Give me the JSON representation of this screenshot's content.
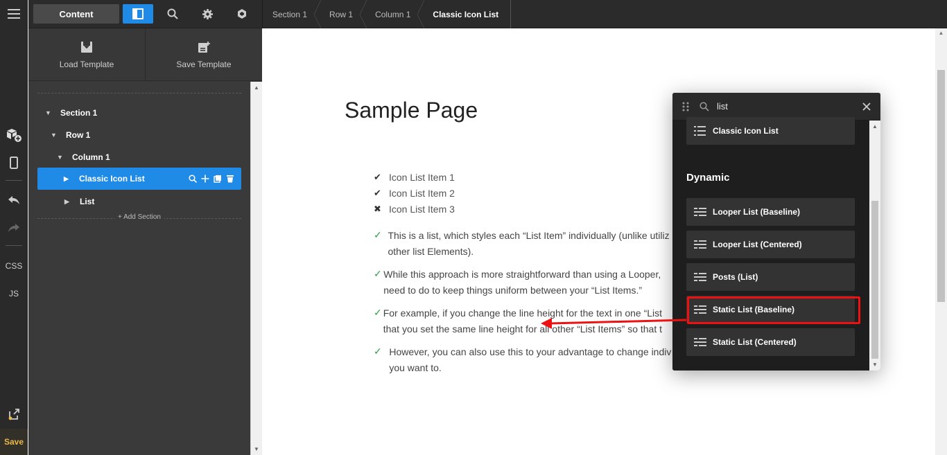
{
  "rail": {
    "css_label": "CSS",
    "js_label": "JS",
    "save_label": "Save"
  },
  "topbar": {
    "content_label": "Content",
    "breadcrumbs": [
      "Section 1",
      "Row 1",
      "Column 1",
      "Classic Icon List"
    ]
  },
  "panel": {
    "load_template": "Load Template",
    "save_template": "Save Template",
    "tree": [
      "Section 1",
      "Row 1",
      "Column 1",
      "Classic Icon List",
      "List"
    ],
    "add_section": "Add Section"
  },
  "canvas": {
    "page_title": "Sample Page",
    "icon_list": [
      {
        "mark": "check",
        "text": "Icon List Item 1"
      },
      {
        "mark": "check",
        "text": "Icon List Item 2"
      },
      {
        "mark": "x",
        "text": "Icon List Item 3"
      }
    ],
    "paragraphs": [
      "This is a list, which styles each “List Item” individually (unlike utiliz other list Elements).",
      "While this approach is more straightforward than using a Looper, need to do to keep things uniform between your “List Items.”",
      "For example, if you change the line height for the text in one “List that you set the same line height for all other “List Items” so that t",
      "However, you can also use this to your advantage to change indiv you want to."
    ]
  },
  "search_modal": {
    "query": "list",
    "top_result": "Classic Icon List",
    "group_title": "Dynamic",
    "results": [
      "Looper List (Baseline)",
      "Looper List (Centered)",
      "Posts (List)",
      "Static List (Baseline)",
      "Static List (Centered)"
    ]
  },
  "colors": {
    "accent": "#1f8be6",
    "save": "#e9b949",
    "highlight": "#ee1111",
    "check": "#2ea14a"
  }
}
